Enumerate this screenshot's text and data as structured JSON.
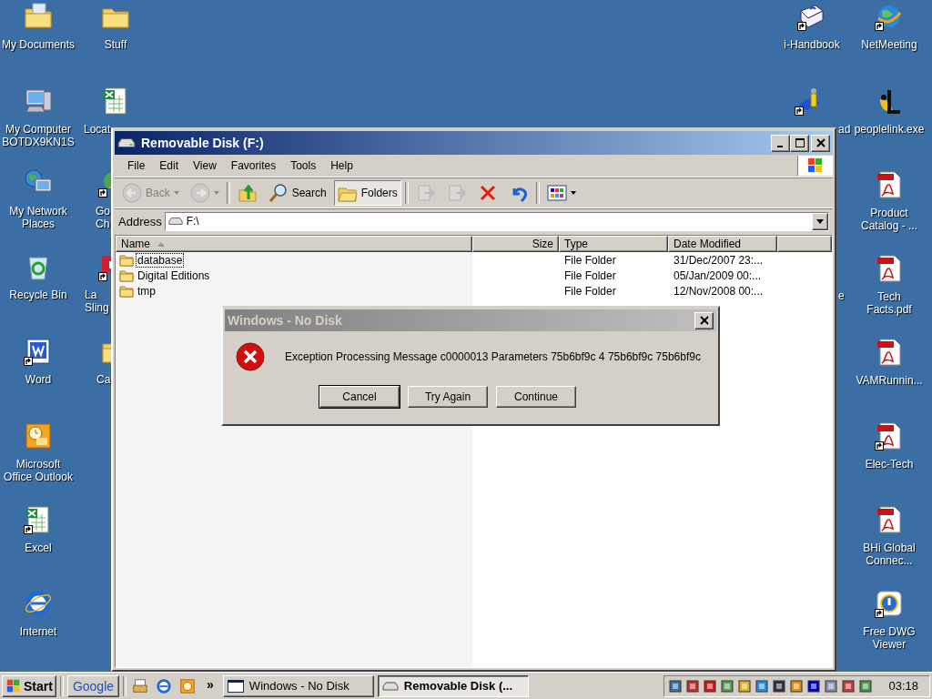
{
  "desktop_icons": [
    {
      "lines": [
        "My Documents"
      ],
      "shortcut": false
    },
    {
      "lines": [
        "My Computer",
        "BOTDX9KN1S"
      ],
      "shortcut": false
    },
    {
      "lines": [
        "My Network",
        "Places"
      ],
      "shortcut": false
    },
    {
      "lines": [
        "Recycle Bin"
      ],
      "shortcut": false
    },
    {
      "lines": [
        "Word"
      ],
      "shortcut": true
    },
    {
      "lines": [
        "Microsoft",
        "Office Outlook"
      ],
      "shortcut": false
    },
    {
      "lines": [
        "Excel"
      ],
      "shortcut": true
    },
    {
      "lines": [
        "Internet"
      ],
      "shortcut": false
    },
    {
      "lines": [
        "Stuff"
      ],
      "shortcut": false
    },
    {
      "lines": [
        "Locat"
      ],
      "shortcut": false
    },
    {
      "lines": [
        "Go",
        "Ch"
      ],
      "shortcut": true
    },
    {
      "lines": [
        "La",
        "Sling"
      ],
      "shortcut": true
    },
    {
      "lines": [
        "Ca"
      ],
      "shortcut": false
    },
    {
      "lines": [
        "i-Handbook"
      ],
      "shortcut": true
    },
    {
      "lines": [
        "ad"
      ],
      "shortcut": true
    },
    {
      "lines": [
        "e"
      ],
      "shortcut": false
    },
    {
      "lines": [
        "NetMeeting"
      ],
      "shortcut": true
    },
    {
      "lines": [
        "peoplelink.exe"
      ],
      "shortcut": false
    },
    {
      "lines": [
        "Product",
        "Catalog - ..."
      ],
      "shortcut": false
    },
    {
      "lines": [
        "Tech",
        "Facts.pdf"
      ],
      "shortcut": false
    },
    {
      "lines": [
        "VAMRunnin..."
      ],
      "shortcut": false
    },
    {
      "lines": [
        "Elec-Tech"
      ],
      "shortcut": true
    },
    {
      "lines": [
        "BHi Global",
        "Connec..."
      ],
      "shortcut": false
    },
    {
      "lines": [
        "Free DWG",
        "Viewer"
      ],
      "shortcut": true
    }
  ],
  "window": {
    "title": "Removable Disk (F:)",
    "menu": [
      "File",
      "Edit",
      "View",
      "Favorites",
      "Tools",
      "Help"
    ],
    "toolbar": [
      {
        "kind": "back",
        "label": "Back",
        "disabled": true
      },
      {
        "kind": "forward",
        "disabled": true
      },
      {
        "kind": "up",
        "disabled": false
      },
      {
        "kind": "search",
        "label": "Search",
        "disabled": false,
        "pressed": false
      },
      {
        "kind": "folders",
        "label": "Folders",
        "disabled": false,
        "pressed": true
      },
      {
        "kind": "move",
        "disabled": true
      },
      {
        "kind": "copy",
        "disabled": true
      },
      {
        "kind": "delete",
        "disabled": false
      },
      {
        "kind": "undo",
        "disabled": false
      },
      {
        "kind": "views",
        "disabled": false
      }
    ],
    "address": {
      "label": "Address",
      "value": "F:\\"
    },
    "columns": [
      {
        "label": "Name",
        "sorted": true
      },
      {
        "label": "Size",
        "sorted": false
      },
      {
        "label": "Type",
        "sorted": false
      },
      {
        "label": "Date Modified",
        "sorted": false
      }
    ],
    "rows": [
      {
        "name": "database",
        "type": "File Folder",
        "modified": "31/Dec/2007 23:...",
        "focused": true
      },
      {
        "name": "Digital Editions",
        "type": "File Folder",
        "modified": "05/Jan/2009 00:...",
        "focused": false
      },
      {
        "name": "tmp",
        "type": "File Folder",
        "modified": "12/Nov/2008 00:...",
        "focused": false
      }
    ]
  },
  "dialog": {
    "title": "Windows - No Disk",
    "message": "Exception Processing Message c0000013 Parameters 75b6bf9c 4 75b6bf9c 75b6bf9c",
    "buttons": [
      {
        "label": "Cancel",
        "default": true
      },
      {
        "label": "Try Again",
        "default": false
      },
      {
        "label": "Continue",
        "default": false
      }
    ]
  },
  "taskbar": {
    "start": "Start",
    "google": "Google",
    "chevron": "»",
    "tasks": [
      {
        "label": "Windows - No Disk",
        "selected": false
      },
      {
        "label": "Removable Disk (...",
        "selected": true
      }
    ],
    "clock": "03:18"
  }
}
